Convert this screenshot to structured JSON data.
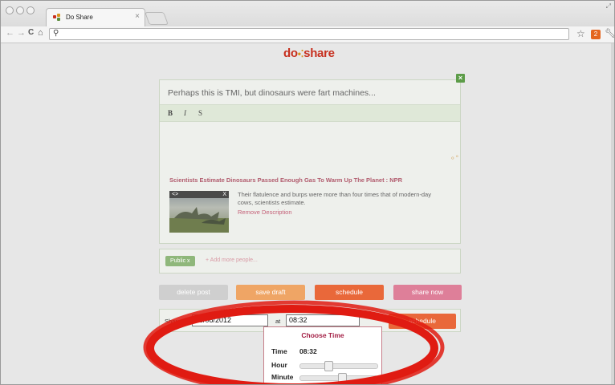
{
  "browser": {
    "tab_title": "Do Share",
    "tab_close": "×",
    "nav_back": "←",
    "nav_forward": "→",
    "nav_reload": "C",
    "nav_home": "⌂",
    "address_value": "",
    "extension_badge": "2"
  },
  "page": {
    "logo_do": "do",
    "logo_share": "share",
    "composer": {
      "message": "Perhaps this is TMI, but dinosaurs were fart machines...",
      "format_buttons": [
        "B",
        "I",
        "S"
      ],
      "close_label": "×"
    },
    "link_preview": {
      "title": "Scientists Estimate Dinosaurs Passed Enough Gas To Warm Up The Planet : NPR",
      "description": "Their flatulence and burps were more than four times that of modern-day cows, scientists estimate.",
      "remove_label": "Remove Description",
      "thumb_prev": "<>",
      "thumb_close": "X"
    },
    "people": {
      "tag": "Public  x",
      "add_more": "+ Add more people..."
    },
    "buttons": {
      "delete_post": "delete post",
      "save_draft": "save draft",
      "schedule_top": "schedule",
      "share_now": "share now"
    },
    "schedule": {
      "share_on_label": "Share on",
      "date_value": "05/08/2012",
      "at_label": "at",
      "time_value": "08:32",
      "schedule_button": "schedule"
    },
    "time_picker": {
      "title": "Choose Time",
      "time_label": "Time",
      "time_value": "08:32",
      "hour_label": "Hour",
      "hour_level": 0.35,
      "minute_label": "Minute",
      "minute_level": 0.54
    }
  },
  "colors": {
    "brand_red": "#c7301f",
    "share_now": "#de7f99",
    "schedule": "#e9683a",
    "public_tag": "#8fb77b",
    "annotation": "#e01b12"
  }
}
